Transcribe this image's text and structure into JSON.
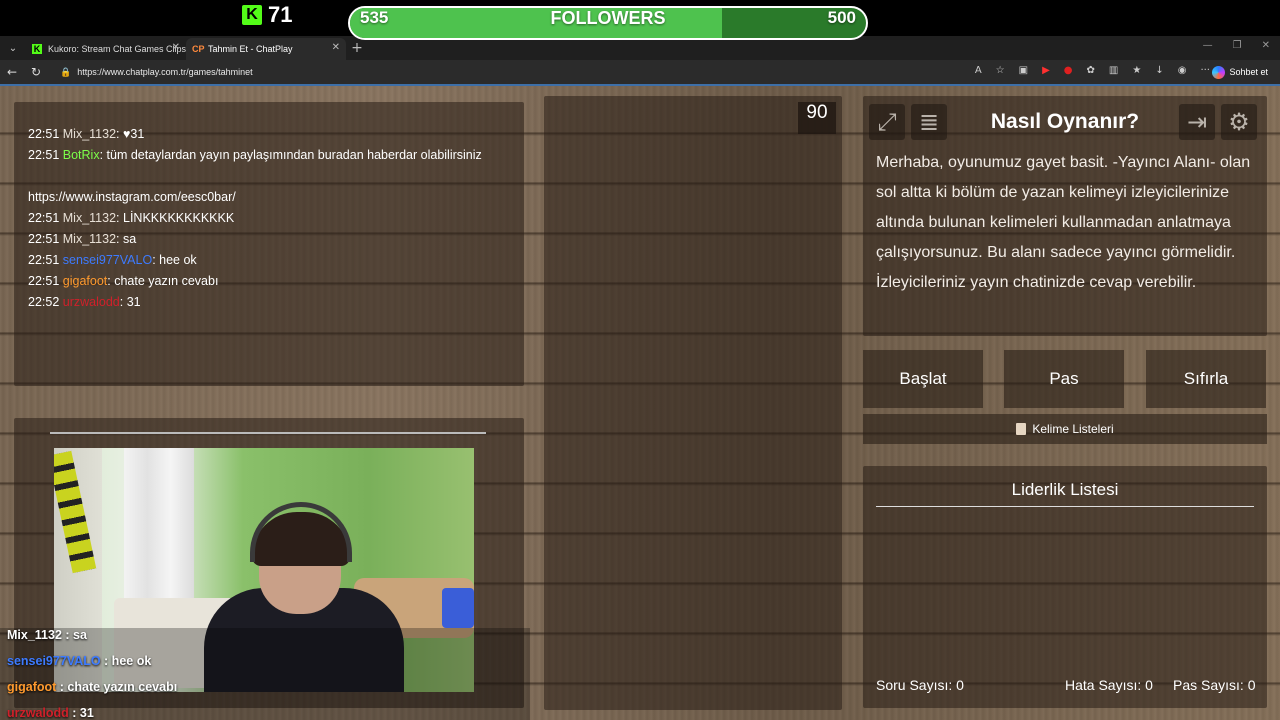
{
  "overlay": {
    "kick_count": "71",
    "followers": {
      "left": "535",
      "title": "FOLLOWERS",
      "right": "500",
      "progress": 0.72
    }
  },
  "browser": {
    "tabs": [
      {
        "favicon": "kick-icon",
        "label": "Kukoro: Stream Chat Games Clips",
        "active": false
      },
      {
        "favicon": "chatplay-icon",
        "label": "Tahmin Et - ChatPlay",
        "active": true
      }
    ],
    "url": "https://www.chatplay.com.tr/games/tahminet",
    "copilot_label": "Sohbet et"
  },
  "chat": {
    "lines": [
      {
        "time": "22:51",
        "user": "Mix_1132",
        "user_color": "#e8e0d6",
        "sep": ": ",
        "text": "♥31"
      },
      {
        "time": "22:51",
        "user": "BotRix",
        "user_color": "#7cff4a",
        "sep": ": ",
        "text": "tüm detaylardan yayın paylaşımından buradan haberdar olabilirsiniz"
      },
      {
        "time": "",
        "user": "",
        "user_color": "#ffffff",
        "sep": "",
        "text": ""
      },
      {
        "time": "",
        "user": "",
        "user_color": "#ffffff",
        "sep": "",
        "text": "https://www.instagram.com/eesc0bar/"
      },
      {
        "time": "22:51",
        "user": "Mix_1132",
        "user_color": "#e8e0d6",
        "sep": ": ",
        "text": "LİNKKKKKKKKKKK"
      },
      {
        "time": "22:51",
        "user": "Mix_1132",
        "user_color": "#e8e0d6",
        "sep": ": ",
        "text": "sa"
      },
      {
        "time": "22:51",
        "user": "sensei977VALO",
        "user_color": "#3d7bff",
        "sep": ": ",
        "text": "hee ok"
      },
      {
        "time": "22:51",
        "user": "gigafoot",
        "user_color": "#ff9a2e",
        "sep": ": ",
        "text": "chate yazın cevabı"
      },
      {
        "time": "22:52",
        "user": "urzwalodd",
        "user_color": "#d0202a",
        "sep": ": ",
        "text": "31"
      }
    ]
  },
  "timer": "90",
  "overlay_chat": [
    {
      "user": "Mix_1132",
      "user_color": "#ffffff",
      "text": " : sa"
    },
    {
      "user": "sensei977VALO",
      "user_color": "#3d7bff",
      "text": " : hee ok"
    },
    {
      "user": "gigafoot",
      "user_color": "#ff9a2e",
      "text": " : chate yazın cevabı"
    },
    {
      "user": "urzwalodd",
      "user_color": "#d0202a",
      "text": " : 31"
    }
  ],
  "howto": {
    "title": "Nasıl Oynanır?",
    "body": "Merhaba, oyunumuz gayet basit. -Yayıncı Alanı- olan sol altta ki bölüm de yazan kelimeyi izleyicilerinize altında bulunan kelimeleri kullanmadan anlatmaya çalışıyorsunuz. Bu alanı sadece yayıncı görmelidir. İzleyicileriniz yayın chatinizde cevap verebilir."
  },
  "buttons": {
    "start": "Başlat",
    "pass": "Pas",
    "reset": "Sıfırla",
    "word_lists": "Kelime Listeleri"
  },
  "leaderboard": {
    "title": "Liderlik Listesi",
    "questions": "Soru Sayısı: 0",
    "errors": "Hata Sayısı: 0",
    "passes": "Pas Sayısı: 0"
  }
}
